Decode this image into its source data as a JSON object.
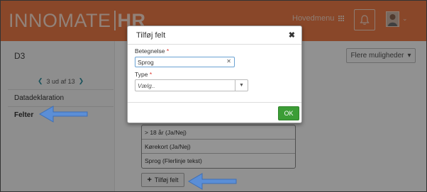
{
  "app": {
    "logo_left": "INNOMATE",
    "logo_right": "HR",
    "main_menu": "Hovedmenu"
  },
  "page": {
    "title": "D3",
    "more_options": "Flere muligheder",
    "pager": "3 ud af 13"
  },
  "sidebar": {
    "items": [
      {
        "label": "Datadeklaration"
      },
      {
        "label": "Felter"
      }
    ]
  },
  "fields": {
    "items": [
      {
        "label": "> 18 år (Ja/Nej)"
      },
      {
        "label": "Kørekort (Ja/Nej)"
      },
      {
        "label": "Sprog (Flerlinje tekst)"
      }
    ],
    "add_label": "Tilføj felt"
  },
  "dialog": {
    "title": "Tilføj felt",
    "name_label": "Betegnelse",
    "name_value": "Sprog",
    "type_label": "Type",
    "type_placeholder": "Vælg..",
    "required_mark": "*",
    "ok_label": "OK"
  },
  "colors": {
    "brand": "#ec7b48",
    "ok_green": "#3c9d36",
    "arrow_blue": "#5b8ed6"
  },
  "icons": {
    "close": "close-icon",
    "clear": "clear-icon",
    "grid": "grid-icon",
    "bell": "bell-icon",
    "plus": "plus-icon",
    "chevron": "chevron-down-icon"
  }
}
